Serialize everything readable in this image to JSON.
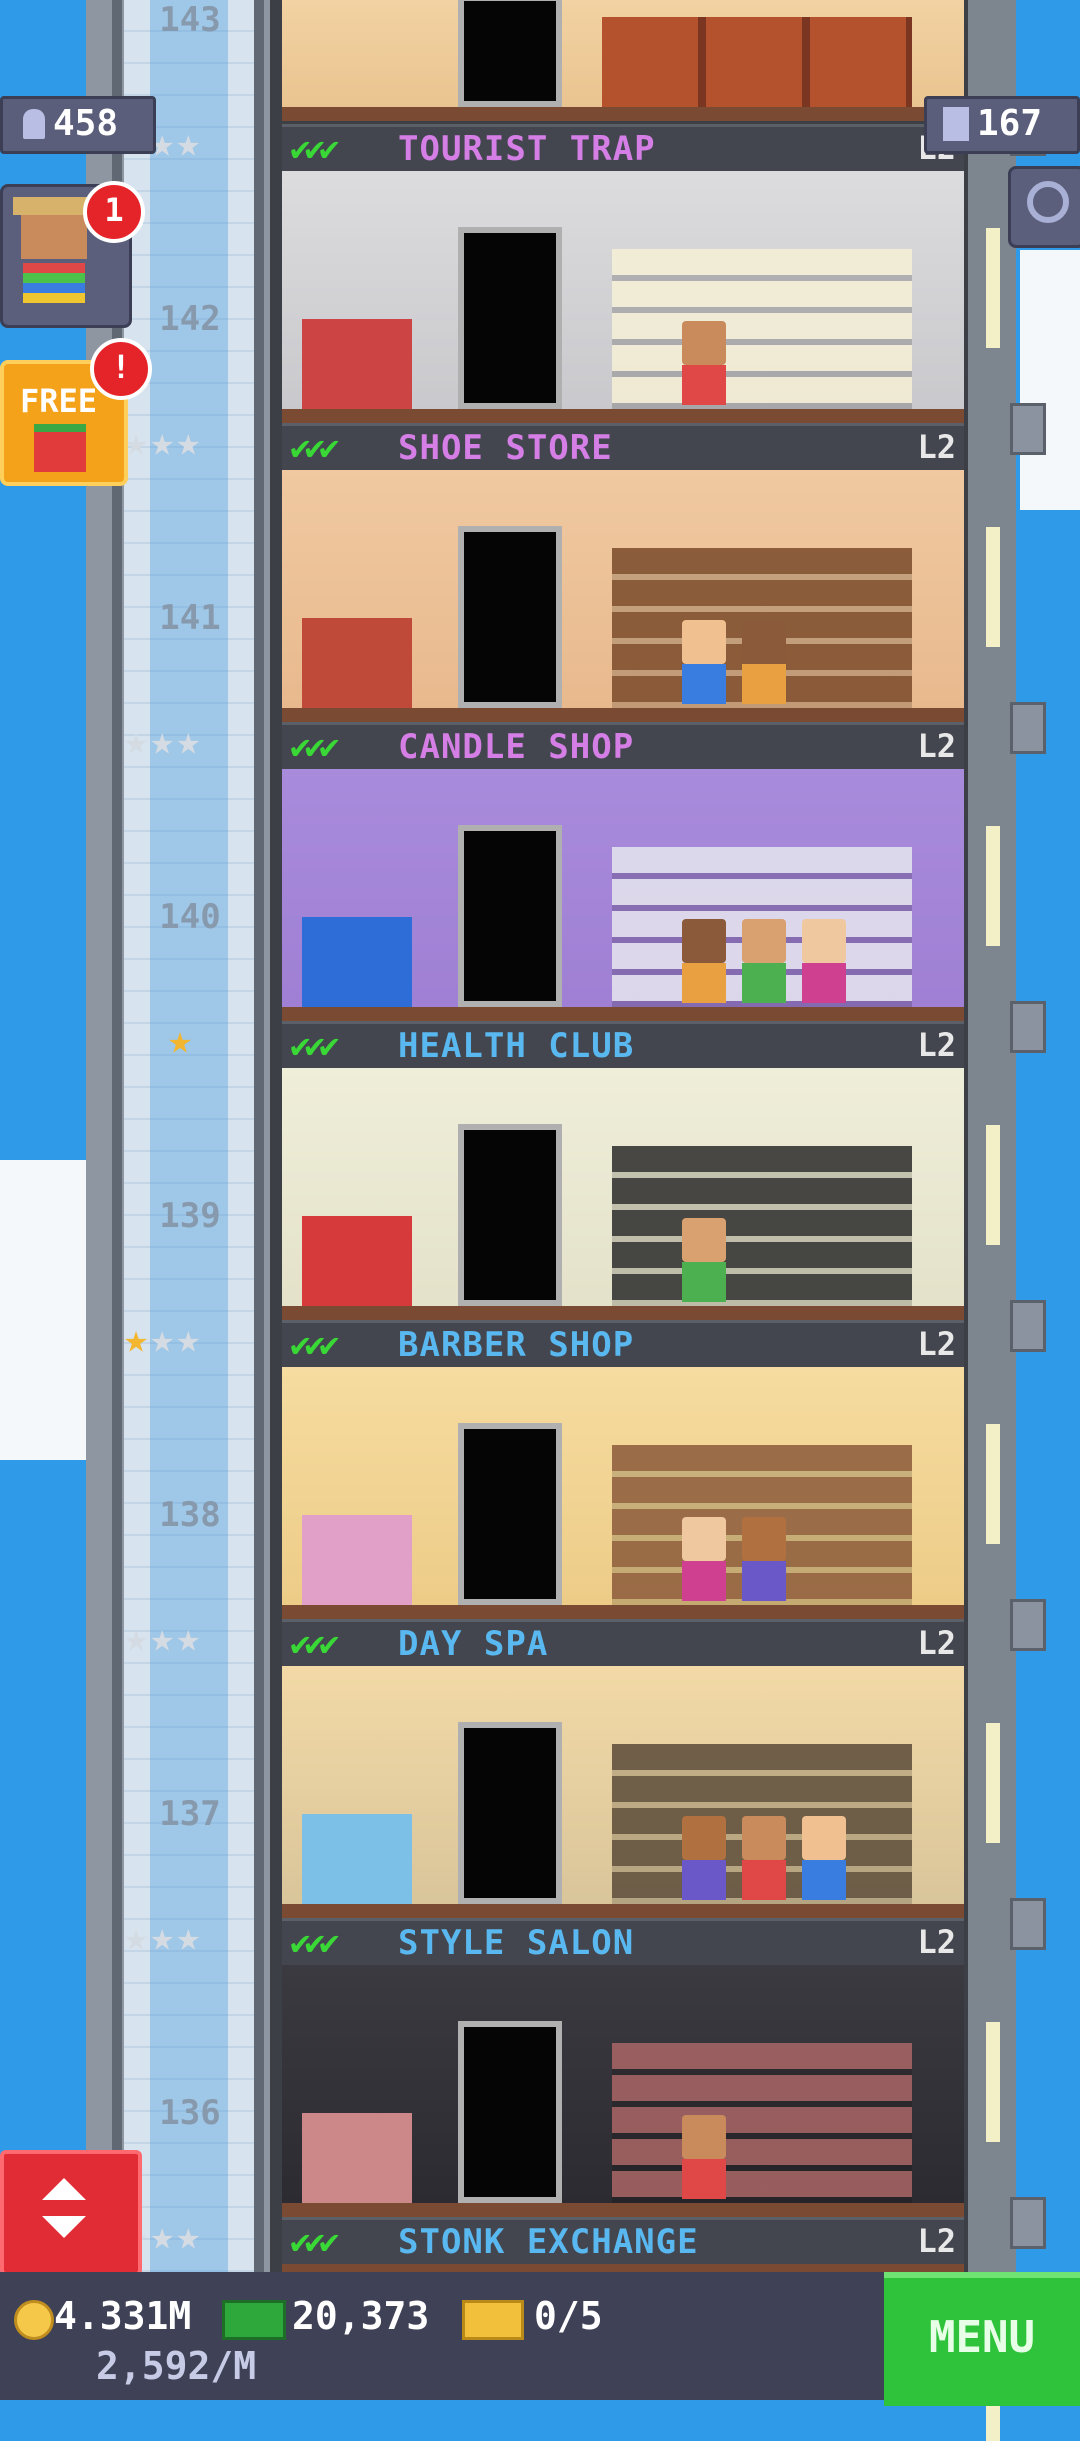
{
  "hud": {
    "population": "458",
    "floors_count": "167",
    "coins": "4.331M",
    "bux": "20,373",
    "tickets": "0/5",
    "income_rate": "2,592/M",
    "menu_label": "MENU",
    "free_label": "FREE",
    "free_badge": "!",
    "vip_badge": "1",
    "free_badge_color": "#e5242a",
    "menu_color": "#2fc23b"
  },
  "floors": [
    {
      "number": "143",
      "label": "TOURIST TRAP",
      "label_color": "#d47ee6",
      "level": "L2",
      "stars": 3,
      "star_on": 0
    },
    {
      "number": "142",
      "label": "SHOE STORE",
      "label_color": "#d47ee6",
      "level": "L2",
      "stars": 3,
      "star_on": 0
    },
    {
      "number": "141",
      "label": "CANDLE SHOP",
      "label_color": "#d47ee6",
      "level": "L2",
      "stars": 3,
      "star_on": 0
    },
    {
      "number": "140",
      "label": "HEALTH CLUB",
      "label_color": "#5ab8f0",
      "level": "L2",
      "stars": 1,
      "star_on": 1
    },
    {
      "number": "139",
      "label": "BARBER SHOP",
      "label_color": "#5ab8f0",
      "level": "L2",
      "stars": 3,
      "star_on": 1
    },
    {
      "number": "138",
      "label": "DAY SPA",
      "label_color": "#5ab8f0",
      "level": "L2",
      "stars": 3,
      "star_on": 0
    },
    {
      "number": "137",
      "label": "STYLE SALON",
      "label_color": "#5ab8f0",
      "level": "L2",
      "stars": 3,
      "star_on": 0
    },
    {
      "number": "136",
      "label": "STONK EXCHANGE",
      "label_color": "#5ab8f0",
      "level": "L2",
      "stars": 3,
      "star_on": 0
    }
  ],
  "checks": "✔✔✔",
  "icons": {
    "population": "person-icon",
    "floors": "building-icon",
    "search": "magnifier-icon",
    "coin": "coin-icon",
    "bux": "bux-icon",
    "ticket": "ticket-icon",
    "elevator": "elevator-arrows-icon"
  }
}
